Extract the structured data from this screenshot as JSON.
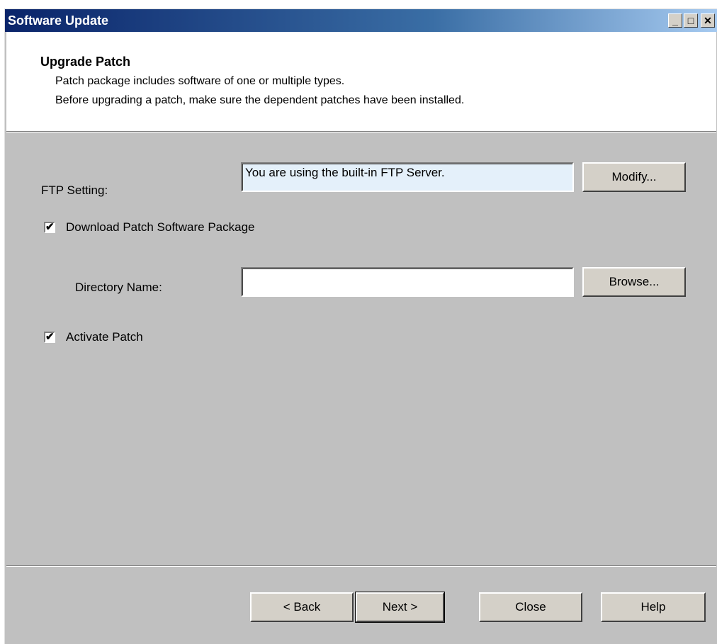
{
  "window": {
    "title": "Software Update",
    "controls": {
      "minimize": "_",
      "maximize": "□",
      "close": "✕"
    }
  },
  "header": {
    "title": "Upgrade Patch",
    "line1": "Patch package includes software of one or multiple types.",
    "line2": "Before upgrading a patch, make sure the dependent patches have been installed."
  },
  "ftp": {
    "label": "FTP Setting:",
    "value": "You are using the built-in FTP Server.",
    "modify_button": "Modify..."
  },
  "download": {
    "checked": true,
    "label": "Download Patch Software Package",
    "check_glyph": "✔"
  },
  "directory": {
    "label": "Directory Name:",
    "value": "",
    "browse_button": "Browse..."
  },
  "activate": {
    "checked": true,
    "label": "Activate Patch",
    "check_glyph": "✔"
  },
  "footer": {
    "back": "< Back",
    "next": "Next >",
    "close": "Close",
    "help": "Help"
  },
  "colors": {
    "title_gradient_start": "#0a246a",
    "dialog_bg": "#c0c0c0",
    "readonly_field_bg": "#e4f0fa"
  }
}
